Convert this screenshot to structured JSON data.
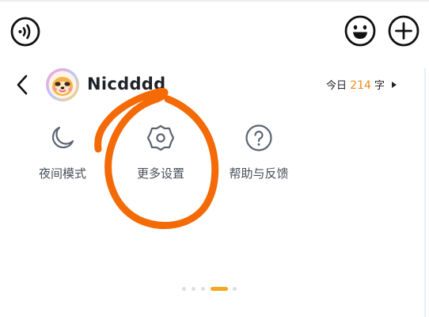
{
  "header": {
    "voice_icon": "voice-wave-icon",
    "emoji_icon": "smiley-icon",
    "add_icon": "plus-circle-icon"
  },
  "profile": {
    "back_icon": "chevron-left-icon",
    "username": "Nicdddd",
    "today_prefix": "今日",
    "today_count": "214",
    "today_suffix": "字"
  },
  "menu": {
    "items": [
      {
        "label": "夜间模式",
        "icon": "moon-icon"
      },
      {
        "label": "更多设置",
        "icon": "gear-icon"
      },
      {
        "label": "帮助与反馈",
        "icon": "help-circle-icon"
      }
    ]
  },
  "pager": {
    "total": 5,
    "active": 4
  },
  "colors": {
    "accent": "#f08a1c",
    "annotation": "#f36a06",
    "icon": "#5a6472",
    "page_dot_active": "#f5a623"
  }
}
